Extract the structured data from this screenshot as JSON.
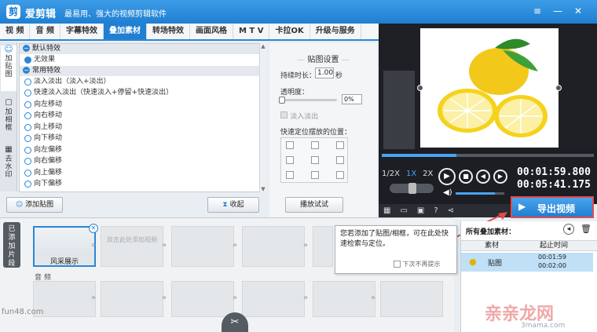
{
  "app": {
    "name": "爱剪辑",
    "slogan": "最易用、强大的视频剪辑软件"
  },
  "menu_tabs": [
    "视  频",
    "音  频",
    "字幕特效",
    "叠加素材",
    "转场特效",
    "画面风格",
    "M T V",
    "卡拉OK",
    "升级与服务"
  ],
  "active_tab": "叠加素材",
  "side_tabs": [
    {
      "label": "加贴图"
    },
    {
      "label": "加相框"
    },
    {
      "label": "去水印"
    }
  ],
  "effects": {
    "group_default": "默认特效",
    "default_item": "无效果",
    "group_common": "常用特效",
    "items": [
      "淡入淡出（淡入+淡出）",
      "快速淡入淡出（快速淡入+停留+快速淡出）",
      "向左移动",
      "向右移动",
      "向上移动",
      "向下移动",
      "向左偏移",
      "向右偏移",
      "向上偏移",
      "向下偏移"
    ]
  },
  "add_sticker_button": "添加贴图",
  "collapse_button": "收起",
  "settings": {
    "title": "贴图设置",
    "duration_label": "持续时长：",
    "duration_value": "1.00",
    "duration_unit": "秒",
    "opacity_label": "透明度：",
    "opacity_value": "0%",
    "fade_label": "淡入淡出",
    "position_label": "快速定位摆放的位置：",
    "preview_button": "播放试试"
  },
  "player": {
    "speeds": [
      "1/2X",
      "1X",
      "2X"
    ],
    "active_speed": "1X",
    "current_time": "00:01:59.800",
    "total_time": "00:05:41.175",
    "progress": 0.35,
    "volume": 0.8
  },
  "export_button": "导出视频",
  "timeline": {
    "side_label": "已添加片段",
    "clip1_label": "风采展示",
    "clip2_text": "双击此处添加视频",
    "audio_label": "音 频"
  },
  "tooltip": {
    "text": "您若添加了贴图/相框，可在此处快速检索与定位。",
    "checkbox": "下次不再提示"
  },
  "overlay_panel": {
    "title": "所有叠加素材：",
    "col_material": "素材",
    "col_time": "起止时间",
    "rows": [
      {
        "name": "贴图",
        "start": "00:01:59",
        "end": "00:02:00"
      }
    ]
  },
  "watermarks": {
    "left": "fun48.com",
    "right": "3mama.com"
  }
}
